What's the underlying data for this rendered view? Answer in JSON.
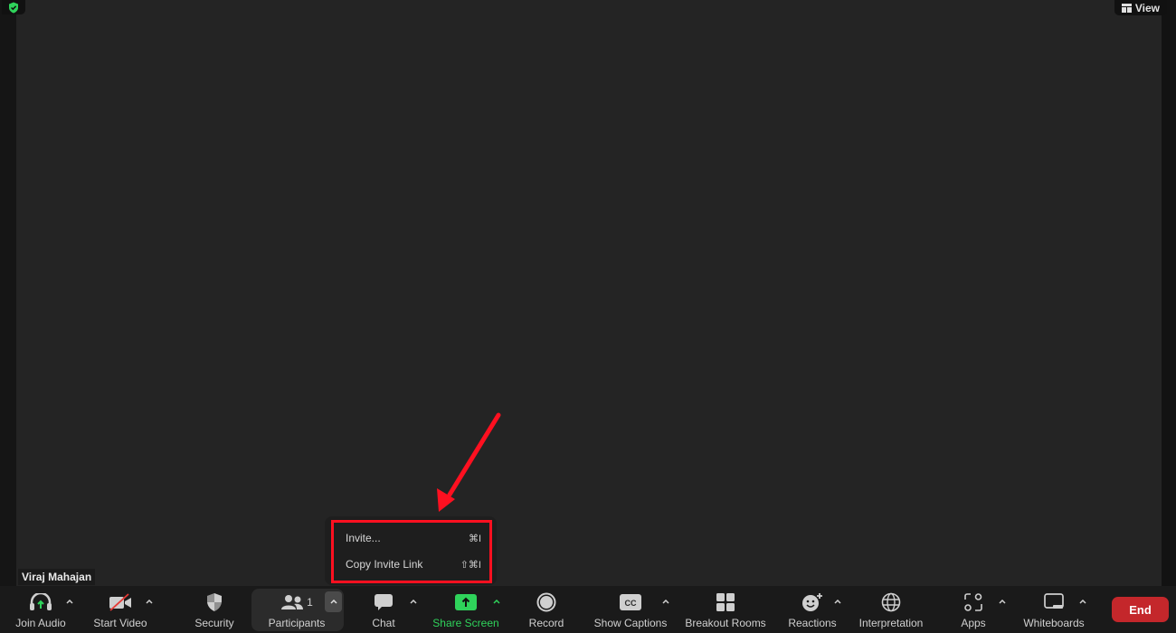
{
  "top": {
    "security_badge_icon": "shield-check-icon",
    "view_button": {
      "icon": "grid-icon",
      "label": "View"
    }
  },
  "video": {
    "participant_name": "Viraj Mahajan"
  },
  "invite_menu": {
    "items": [
      {
        "label": "Invite...",
        "shortcut": "⌘I"
      },
      {
        "label": "Copy Invite Link",
        "shortcut": "⇧⌘I"
      }
    ],
    "annotation_color": "#ff1020"
  },
  "toolbar": {
    "items": [
      {
        "id": "join-audio",
        "label": "Join Audio",
        "icon": "headphones-icon",
        "has_caret": true
      },
      {
        "id": "start-video",
        "label": "Start Video",
        "icon": "video-off-icon",
        "has_caret": true
      },
      {
        "id": "security",
        "label": "Security",
        "icon": "shield-icon",
        "has_caret": false
      },
      {
        "id": "participants",
        "label": "Participants",
        "icon": "participants-icon",
        "count": "1",
        "has_caret": true
      },
      {
        "id": "chat",
        "label": "Chat",
        "icon": "chat-icon",
        "has_caret": true
      },
      {
        "id": "share-screen",
        "label": "Share Screen",
        "icon": "share-screen-icon",
        "has_caret": true
      },
      {
        "id": "record",
        "label": "Record",
        "icon": "record-icon",
        "has_caret": false
      },
      {
        "id": "show-captions",
        "label": "Show Captions",
        "icon": "cc-icon",
        "has_caret": true
      },
      {
        "id": "breakout-rooms",
        "label": "Breakout Rooms",
        "icon": "breakout-rooms-icon",
        "has_caret": false
      },
      {
        "id": "reactions",
        "label": "Reactions",
        "icon": "reactions-icon",
        "has_caret": true
      },
      {
        "id": "interpretation",
        "label": "Interpretation",
        "icon": "globe-icon",
        "has_caret": false
      },
      {
        "id": "apps",
        "label": "Apps",
        "icon": "apps-icon",
        "has_caret": true
      },
      {
        "id": "whiteboards",
        "label": "Whiteboards",
        "icon": "whiteboard-icon",
        "has_caret": true
      }
    ],
    "end_label": "End",
    "colors": {
      "share_green": "#2fd35b",
      "end_red": "#c4272b"
    }
  }
}
